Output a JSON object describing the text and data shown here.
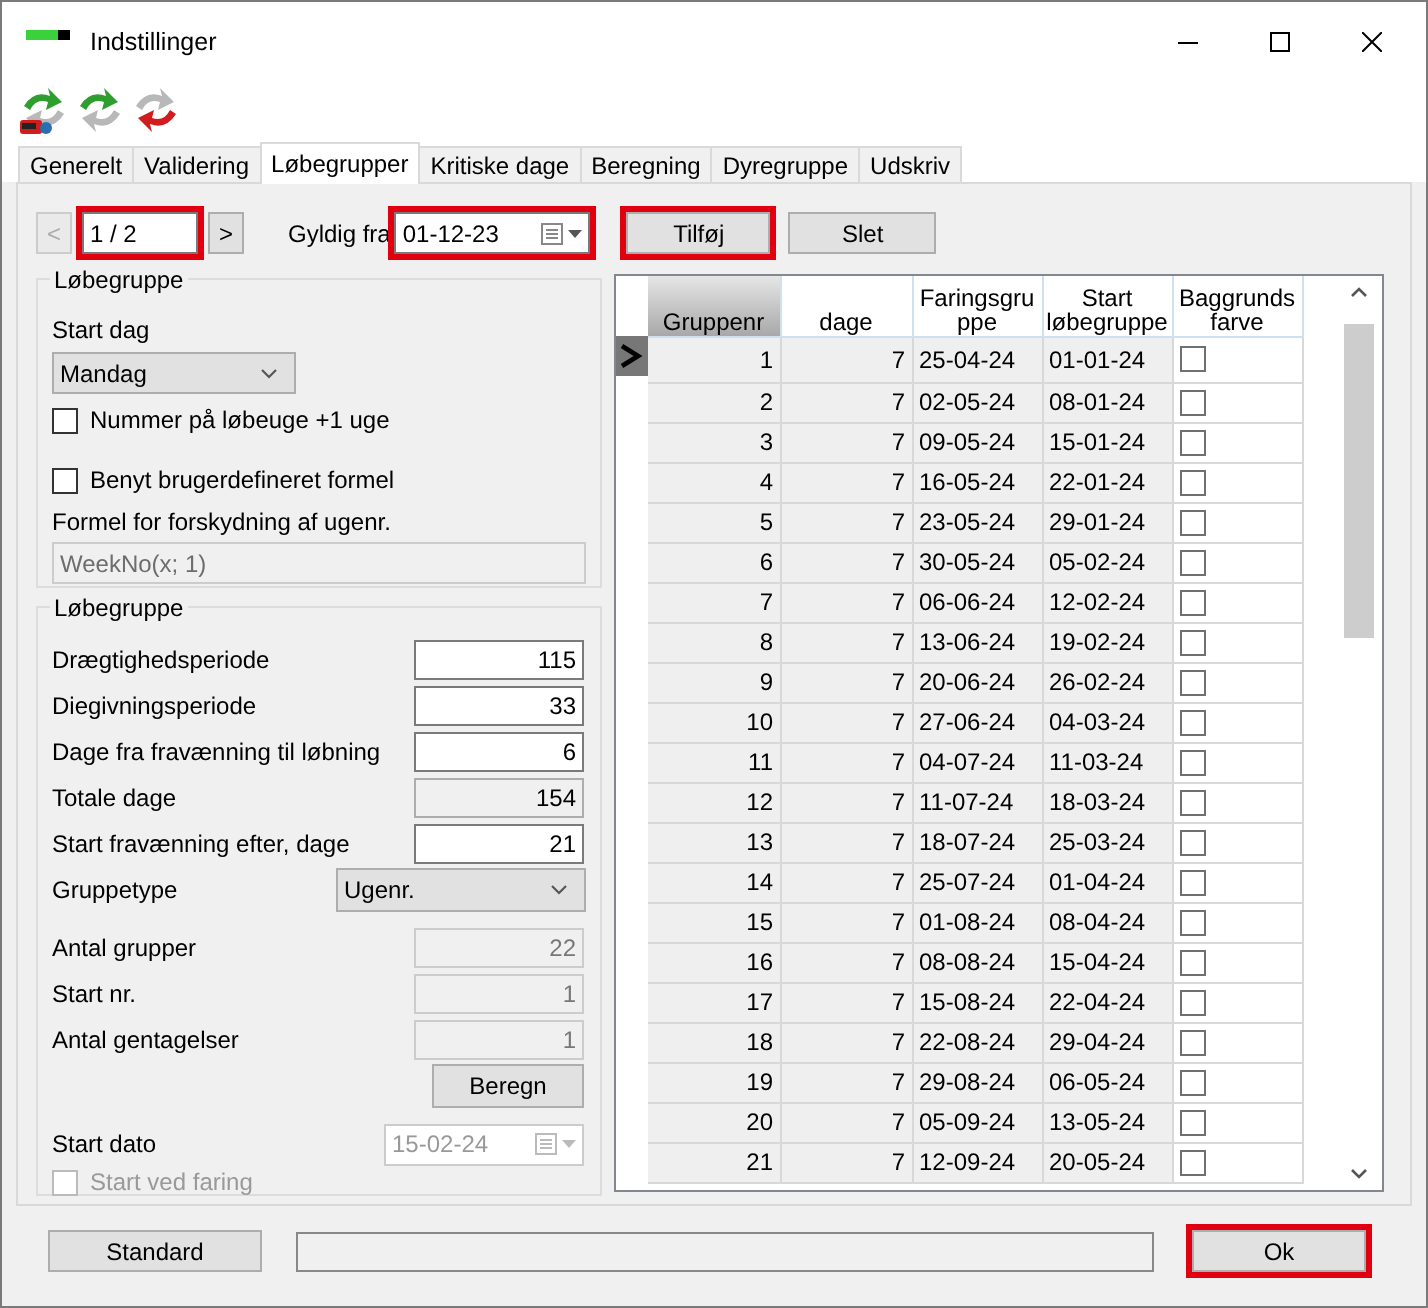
{
  "window": {
    "title": "Indstillinger"
  },
  "tabs": [
    {
      "label": "Generelt",
      "selected": false
    },
    {
      "label": "Validering",
      "selected": false
    },
    {
      "label": "Løbegrupper",
      "selected": true
    },
    {
      "label": "Kritiske dage",
      "selected": false
    },
    {
      "label": "Beregning",
      "selected": false
    },
    {
      "label": "Dyregruppe",
      "selected": false
    },
    {
      "label": "Udskriv",
      "selected": false
    }
  ],
  "navigator": {
    "prev": "<",
    "prev_disabled": true,
    "position": "1 / 2",
    "next": ">",
    "highlighted": true
  },
  "valid_from": {
    "label": "Gyldig fra",
    "value": "01-12-23",
    "highlighted": true
  },
  "actions": [
    {
      "label": "Tilføj",
      "highlighted": true
    },
    {
      "label": "Slet",
      "highlighted": false
    }
  ],
  "group_settings": {
    "title": "Løbegruppe",
    "start_day_label": "Start dag",
    "start_day": "Mandag",
    "checkboxes": [
      {
        "label": "Nummer på løbeuge +1 uge",
        "checked": false
      },
      {
        "label": "Benyt brugerdefineret formel",
        "checked": false
      }
    ],
    "formula_label": "Formel for forskydning af ugenr.",
    "formula": "WeekNo(x; 1)",
    "formula_disabled": true
  },
  "periods": {
    "title": "Løbegruppe",
    "fields": [
      {
        "kind": "input",
        "label": "Drægtighedsperiode",
        "value": "115"
      },
      {
        "kind": "input",
        "label": "Diegivningsperiode",
        "value": "33"
      },
      {
        "kind": "input",
        "label": "Dage fra fravænning til løbning",
        "value": "6"
      },
      {
        "kind": "readonly",
        "label": "Totale dage",
        "value": "154"
      },
      {
        "kind": "input",
        "label": "Start fravænning efter, dage",
        "value": "21"
      },
      {
        "kind": "select",
        "label": "Gruppetype",
        "value": "Ugenr."
      },
      {
        "kind": "disabled",
        "label": "Antal grupper",
        "value": "22"
      },
      {
        "kind": "disabled",
        "label": "Start nr.",
        "value": "1"
      },
      {
        "kind": "disabled",
        "label": "Antal gentagelser",
        "value": "1"
      }
    ],
    "calc_button": "Beregn",
    "start_date": {
      "label": "Start dato",
      "value": "15-02-24",
      "disabled": true
    },
    "start_at_farrowing": {
      "label": "Start ved faring",
      "checked": false,
      "disabled": true
    }
  },
  "grid": {
    "columns": [
      "Gruppenr",
      "dage",
      "Faringsgruppe",
      "Start løbegruppe",
      "Baggrunds farve"
    ],
    "rows": [
      {
        "selected": true,
        "cells": [
          "1",
          "7",
          "25-04-24",
          "01-01-24"
        ],
        "background": false
      },
      {
        "selected": false,
        "cells": [
          "2",
          "7",
          "02-05-24",
          "08-01-24"
        ],
        "background": false
      },
      {
        "selected": false,
        "cells": [
          "3",
          "7",
          "09-05-24",
          "15-01-24"
        ],
        "background": false
      },
      {
        "selected": false,
        "cells": [
          "4",
          "7",
          "16-05-24",
          "22-01-24"
        ],
        "background": false
      },
      {
        "selected": false,
        "cells": [
          "5",
          "7",
          "23-05-24",
          "29-01-24"
        ],
        "background": false
      },
      {
        "selected": false,
        "cells": [
          "6",
          "7",
          "30-05-24",
          "05-02-24"
        ],
        "background": false
      },
      {
        "selected": false,
        "cells": [
          "7",
          "7",
          "06-06-24",
          "12-02-24"
        ],
        "background": false
      },
      {
        "selected": false,
        "cells": [
          "8",
          "7",
          "13-06-24",
          "19-02-24"
        ],
        "background": false
      },
      {
        "selected": false,
        "cells": [
          "9",
          "7",
          "20-06-24",
          "26-02-24"
        ],
        "background": false
      },
      {
        "selected": false,
        "cells": [
          "10",
          "7",
          "27-06-24",
          "04-03-24"
        ],
        "background": false
      },
      {
        "selected": false,
        "cells": [
          "11",
          "7",
          "04-07-24",
          "11-03-24"
        ],
        "background": false
      },
      {
        "selected": false,
        "cells": [
          "12",
          "7",
          "11-07-24",
          "18-03-24"
        ],
        "background": false
      },
      {
        "selected": false,
        "cells": [
          "13",
          "7",
          "18-07-24",
          "25-03-24"
        ],
        "background": false
      },
      {
        "selected": false,
        "cells": [
          "14",
          "7",
          "25-07-24",
          "01-04-24"
        ],
        "background": false
      },
      {
        "selected": false,
        "cells": [
          "15",
          "7",
          "01-08-24",
          "08-04-24"
        ],
        "background": false
      },
      {
        "selected": false,
        "cells": [
          "16",
          "7",
          "08-08-24",
          "15-04-24"
        ],
        "background": false
      },
      {
        "selected": false,
        "cells": [
          "17",
          "7",
          "15-08-24",
          "22-04-24"
        ],
        "background": false
      },
      {
        "selected": false,
        "cells": [
          "18",
          "7",
          "22-08-24",
          "29-04-24"
        ],
        "background": false
      },
      {
        "selected": false,
        "cells": [
          "19",
          "7",
          "29-08-24",
          "06-05-24"
        ],
        "background": false
      },
      {
        "selected": false,
        "cells": [
          "20",
          "7",
          "05-09-24",
          "13-05-24"
        ],
        "background": false
      },
      {
        "selected": false,
        "cells": [
          "21",
          "7",
          "12-09-24",
          "20-05-24"
        ],
        "background": false
      }
    ]
  },
  "footer": {
    "default_button": "Standard",
    "ok_button": "Ok",
    "ok_highlighted": true
  }
}
